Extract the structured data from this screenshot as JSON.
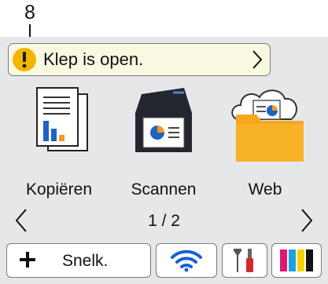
{
  "callout": {
    "number": "8"
  },
  "status_bar": {
    "icon": "warning-icon",
    "text": "Klep is open.",
    "chevron": "chevron-right-icon",
    "accent_color": "#f2b600"
  },
  "apps": [
    {
      "label": "Kopiëren",
      "icon": "copy-icon"
    },
    {
      "label": "Scannen",
      "icon": "scan-icon"
    },
    {
      "label": "Web",
      "icon": "web-cloud-folder-icon"
    }
  ],
  "pager": {
    "text": "1 / 2",
    "prev_icon": "chevron-left-icon",
    "next_icon": "chevron-right-icon"
  },
  "bottom_bar": {
    "shortcuts": {
      "label": "Snelk.",
      "icon": "plus-icon"
    },
    "wifi": {
      "icon": "wifi-icon",
      "color": "#1a5fd6"
    },
    "settings": {
      "icon": "tools-icon"
    },
    "ink": {
      "icon": "ink-levels-icon",
      "colors": [
        "#e0157a",
        "#1ea0e0",
        "#f5d300",
        "#111111"
      ]
    }
  }
}
